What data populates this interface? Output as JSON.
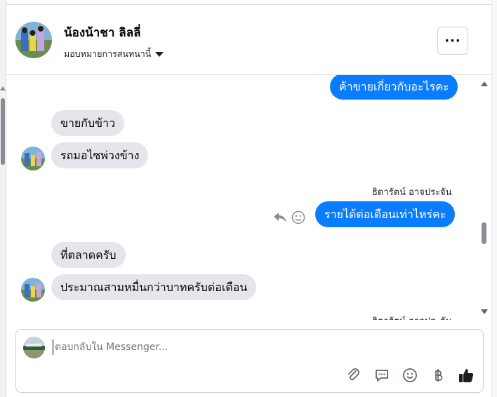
{
  "header": {
    "contact_name": "น้องน้าชา ลิลลี่",
    "assign_label": "มอบหมายการสนทนานี้",
    "more_label": "···"
  },
  "messages": [
    {
      "dir": "out",
      "text": "ค้าขายเกี่ยวกับอะไรคะ"
    },
    {
      "dir": "in",
      "text": "ขายกับข้าว"
    },
    {
      "dir": "in",
      "text": "รถมอไซพ่วงข้าง"
    },
    {
      "dir": "sender",
      "text": "ธิดารัตน์ อาจประจัน"
    },
    {
      "dir": "out",
      "text": "รายได้ต่อเดือนเท่าไหร่คะ"
    },
    {
      "dir": "in",
      "text": "ที่ตลาดครับ"
    },
    {
      "dir": "in",
      "text": "ประมาณสามหมื่นกว่าบาทครับต่อเดือน"
    },
    {
      "dir": "sender",
      "text": "ธิดารัตน์ อาจประจัน"
    }
  ],
  "composer": {
    "placeholder": "ตอบกลับใน Messenger..."
  },
  "icons": [
    "paperclip-icon",
    "chat-icon",
    "emoji-icon",
    "baht-icon",
    "thumbs-up-icon",
    "reply-icon",
    "react-icon",
    "ellipsis-icon"
  ],
  "colors": {
    "outgoing_bubble": "#0a7cff",
    "incoming_bubble": "#e4e6eb"
  }
}
